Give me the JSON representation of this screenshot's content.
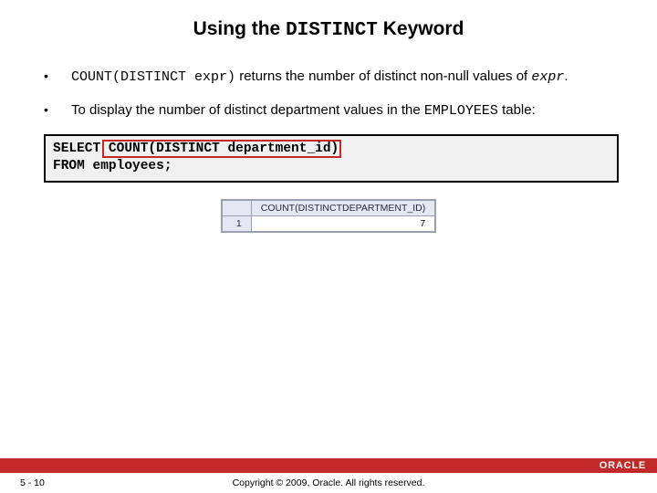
{
  "title": {
    "part1": "Using the ",
    "keyword": "DISTINCT",
    "part2": " Keyword"
  },
  "bullets": [
    {
      "dot": "•",
      "segments": {
        "code1": "COUNT(DISTINCT expr)",
        "text1": " returns the number of distinct non-null values of ",
        "code2": "expr",
        "text2": "."
      }
    },
    {
      "dot": "•",
      "segments": {
        "text1": "To display the number of distinct department values in the ",
        "code1": "EMPLOYEES",
        "text2": " table:"
      }
    }
  ],
  "code": {
    "line1_kw": "SELECT",
    "line1_rest": " COUNT(DISTINCT department_id)",
    "line2_kw": "FROM",
    "line2_rest": "   employees;"
  },
  "result": {
    "header": "COUNT(DISTINCTDEPARTMENT_ID)",
    "rownum": "1",
    "value": "7"
  },
  "footer": {
    "page": "5 - 10",
    "copyright": "Copyright © 2009, Oracle. All rights reserved.",
    "brand": "ORACLE"
  }
}
